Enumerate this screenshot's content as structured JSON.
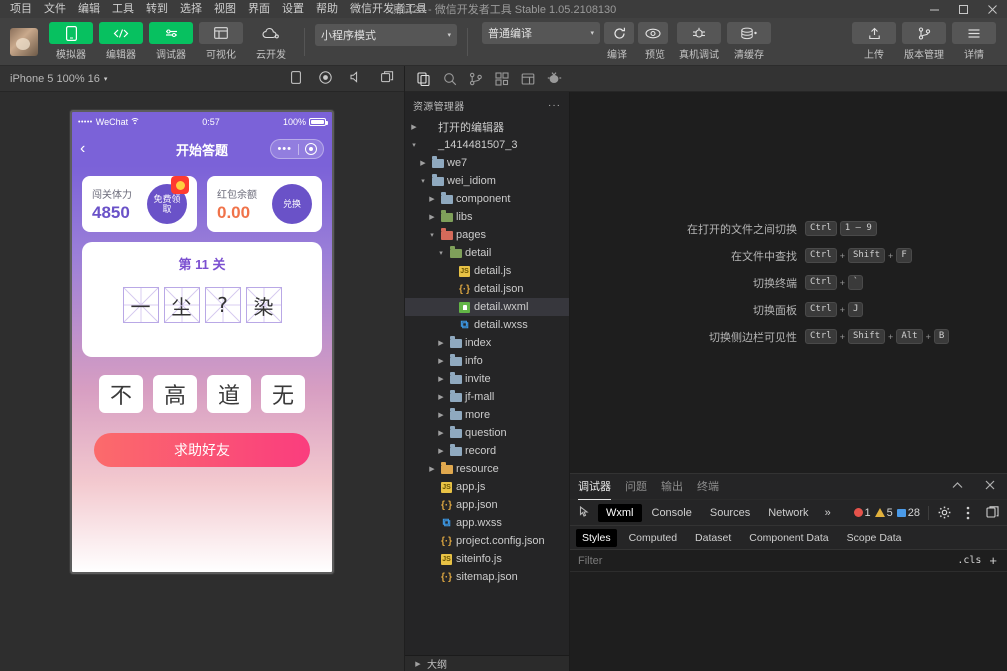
{
  "window": {
    "title": "测试22 - 微信开发者工具 Stable 1.05.2108130",
    "menus": [
      "项目",
      "文件",
      "编辑",
      "工具",
      "转到",
      "选择",
      "视图",
      "界面",
      "设置",
      "帮助",
      "微信开发者工具"
    ],
    "controls": {
      "minimize": "minimize-icon",
      "maximize": "maximize-icon",
      "close": "close-icon"
    }
  },
  "toolbar": {
    "avatar": "user-avatar",
    "left_buttons": [
      {
        "label": "模拟器",
        "icon": "phone-icon",
        "style": "green"
      },
      {
        "label": "编辑器",
        "icon": "code-icon",
        "style": "green"
      },
      {
        "label": "调试器",
        "icon": "debugger-icon",
        "style": "green"
      },
      {
        "label": "可视化",
        "icon": "layout-icon",
        "style": "grey"
      },
      {
        "label": "云开发",
        "icon": "cloud-icon",
        "style": "plain"
      }
    ],
    "mode_select": {
      "value": "小程序模式",
      "caret": "chevron-down-icon"
    },
    "compile_select": {
      "value": "普通编译",
      "caret": "chevron-down-icon"
    },
    "compile_label": "编译",
    "preview_label": "预览",
    "right_buttons": [
      {
        "label": "真机调试",
        "icon": "device-debug-icon"
      },
      {
        "label": "清缓存",
        "icon": "clear-cache-icon"
      }
    ],
    "far_right_buttons": [
      {
        "label": "上传",
        "icon": "upload-icon"
      },
      {
        "label": "版本管理",
        "icon": "branch-icon"
      },
      {
        "label": "详情",
        "icon": "menu-icon"
      }
    ]
  },
  "simulator": {
    "device_bar": {
      "text": "iPhone 5 100% 16",
      "caret": "chevron-down-icon"
    },
    "bar_icons": [
      "rotate-device-icon",
      "record-icon",
      "volume-icon",
      "window-icon"
    ],
    "phone": {
      "status_bar": {
        "dots": "•••••",
        "carrier": "WeChat",
        "wifi": "wifi-icon",
        "time": "0:57",
        "battery_text": "100%"
      },
      "nav": {
        "back": "back-arrow-icon",
        "title": "开始答题",
        "menu_dots": "•••",
        "target": "capsule-target-icon"
      },
      "stats": [
        {
          "label": "闯关体力",
          "value": "4850",
          "button": "免费领取",
          "badge": true
        },
        {
          "label": "红包余额",
          "value": "0.00",
          "button": "兑换",
          "badge": false
        }
      ],
      "quiz": {
        "level": "第 11 关",
        "cells": [
          "一",
          "尘",
          "?",
          "染"
        ],
        "options": [
          "不",
          "高",
          "道",
          "无"
        ]
      },
      "help_button": "求助好友"
    }
  },
  "editor": {
    "activity_icons": [
      "files-icon",
      "search-icon",
      "source-control-icon",
      "extensions-icon",
      "layout-icon",
      "debug-icon"
    ],
    "explorer": {
      "title": "资源管理器",
      "more": "···",
      "tree": [
        {
          "label": "打开的编辑器",
          "depth": 0,
          "twisty": "collapsed",
          "type": "section"
        },
        {
          "label": "_1414481507_3",
          "depth": 0,
          "twisty": "expanded",
          "type": "section"
        },
        {
          "label": "we7",
          "depth": 1,
          "twisty": "collapsed",
          "type": "folder",
          "color": "blue"
        },
        {
          "label": "wei_idiom",
          "depth": 1,
          "twisty": "expanded",
          "type": "folder",
          "color": "blue"
        },
        {
          "label": "component",
          "depth": 2,
          "twisty": "collapsed",
          "type": "folder",
          "color": "blue"
        },
        {
          "label": "libs",
          "depth": 2,
          "twisty": "collapsed",
          "type": "folder",
          "color": "green"
        },
        {
          "label": "pages",
          "depth": 2,
          "twisty": "expanded",
          "type": "folder",
          "color": "red"
        },
        {
          "label": "detail",
          "depth": 3,
          "twisty": "expanded",
          "type": "folder",
          "color": "green"
        },
        {
          "label": "detail.js",
          "depth": 4,
          "twisty": "none",
          "type": "js"
        },
        {
          "label": "detail.json",
          "depth": 4,
          "twisty": "none",
          "type": "json"
        },
        {
          "label": "detail.wxml",
          "depth": 4,
          "twisty": "none",
          "type": "wxml",
          "selected": true
        },
        {
          "label": "detail.wxss",
          "depth": 4,
          "twisty": "none",
          "type": "wxss"
        },
        {
          "label": "index",
          "depth": 3,
          "twisty": "collapsed",
          "type": "folder",
          "color": "blue"
        },
        {
          "label": "info",
          "depth": 3,
          "twisty": "collapsed",
          "type": "folder",
          "color": "blue"
        },
        {
          "label": "invite",
          "depth": 3,
          "twisty": "collapsed",
          "type": "folder",
          "color": "blue"
        },
        {
          "label": "jf-mall",
          "depth": 3,
          "twisty": "collapsed",
          "type": "folder",
          "color": "blue"
        },
        {
          "label": "more",
          "depth": 3,
          "twisty": "collapsed",
          "type": "folder",
          "color": "blue"
        },
        {
          "label": "question",
          "depth": 3,
          "twisty": "collapsed",
          "type": "folder",
          "color": "blue"
        },
        {
          "label": "record",
          "depth": 3,
          "twisty": "collapsed",
          "type": "folder",
          "color": "blue"
        },
        {
          "label": "resource",
          "depth": 2,
          "twisty": "collapsed",
          "type": "folder",
          "color": "orange"
        },
        {
          "label": "app.js",
          "depth": 2,
          "twisty": "none",
          "type": "js"
        },
        {
          "label": "app.json",
          "depth": 2,
          "twisty": "none",
          "type": "json"
        },
        {
          "label": "app.wxss",
          "depth": 2,
          "twisty": "none",
          "type": "wxss"
        },
        {
          "label": "project.config.json",
          "depth": 2,
          "twisty": "none",
          "type": "json"
        },
        {
          "label": "siteinfo.js",
          "depth": 2,
          "twisty": "none",
          "type": "js"
        },
        {
          "label": "sitemap.json",
          "depth": 2,
          "twisty": "none",
          "type": "json"
        }
      ],
      "outline": "大纲"
    },
    "shortcuts": [
      {
        "text": "在打开的文件之间切换",
        "keys": [
          "Ctrl",
          "1 – 9"
        ]
      },
      {
        "text": "在文件中查找",
        "keys": [
          "Ctrl",
          "+",
          "Shift",
          "+",
          "F"
        ]
      },
      {
        "text": "切换终端",
        "keys": [
          "Ctrl",
          "+",
          "`"
        ]
      },
      {
        "text": "切换面板",
        "keys": [
          "Ctrl",
          "+",
          "J"
        ]
      },
      {
        "text": "切换侧边栏可见性",
        "keys": [
          "Ctrl",
          "+",
          "Shift",
          "+",
          "Alt",
          "+",
          "B"
        ]
      }
    ]
  },
  "devpanel": {
    "tabs": [
      {
        "label": "调试器",
        "active": true
      },
      {
        "label": "问题",
        "active": false
      },
      {
        "label": "输出",
        "active": false
      },
      {
        "label": "终端",
        "active": false
      }
    ],
    "collapse_icon": "chevron-up-icon",
    "close_icon": "close-icon",
    "devtools": {
      "inspect_icon": "inspect-element-icon",
      "tabs": [
        {
          "label": "Wxml",
          "active": true
        },
        {
          "label": "Console",
          "active": false
        },
        {
          "label": "Sources",
          "active": false
        },
        {
          "label": "Network",
          "active": false
        }
      ],
      "more": "»",
      "counts": {
        "errors": "1",
        "warnings": "5",
        "info": "28"
      },
      "settings_icon": "gear-icon",
      "kebab_icon": "more-vertical-icon",
      "dock_icon": "dock-icon"
    },
    "styles": {
      "tabs": [
        {
          "label": "Styles",
          "active": true
        },
        {
          "label": "Computed",
          "active": false
        },
        {
          "label": "Dataset",
          "active": false
        },
        {
          "label": "Component Data",
          "active": false
        },
        {
          "label": "Scope Data",
          "active": false
        }
      ],
      "filter_placeholder": "Filter",
      "filter_value": "",
      "cls_label": ".cls",
      "add_label": "+"
    }
  },
  "colors": {
    "accent_green": "#07c160",
    "phone_purple": "#7b62d8",
    "value_purple": "#6a52c8",
    "value_orange": "#f0734a",
    "help_pink": "#fa3d7e",
    "error_red": "#e5534b",
    "warn_yellow": "#e2b13c",
    "info_blue": "#4a9ae8"
  }
}
